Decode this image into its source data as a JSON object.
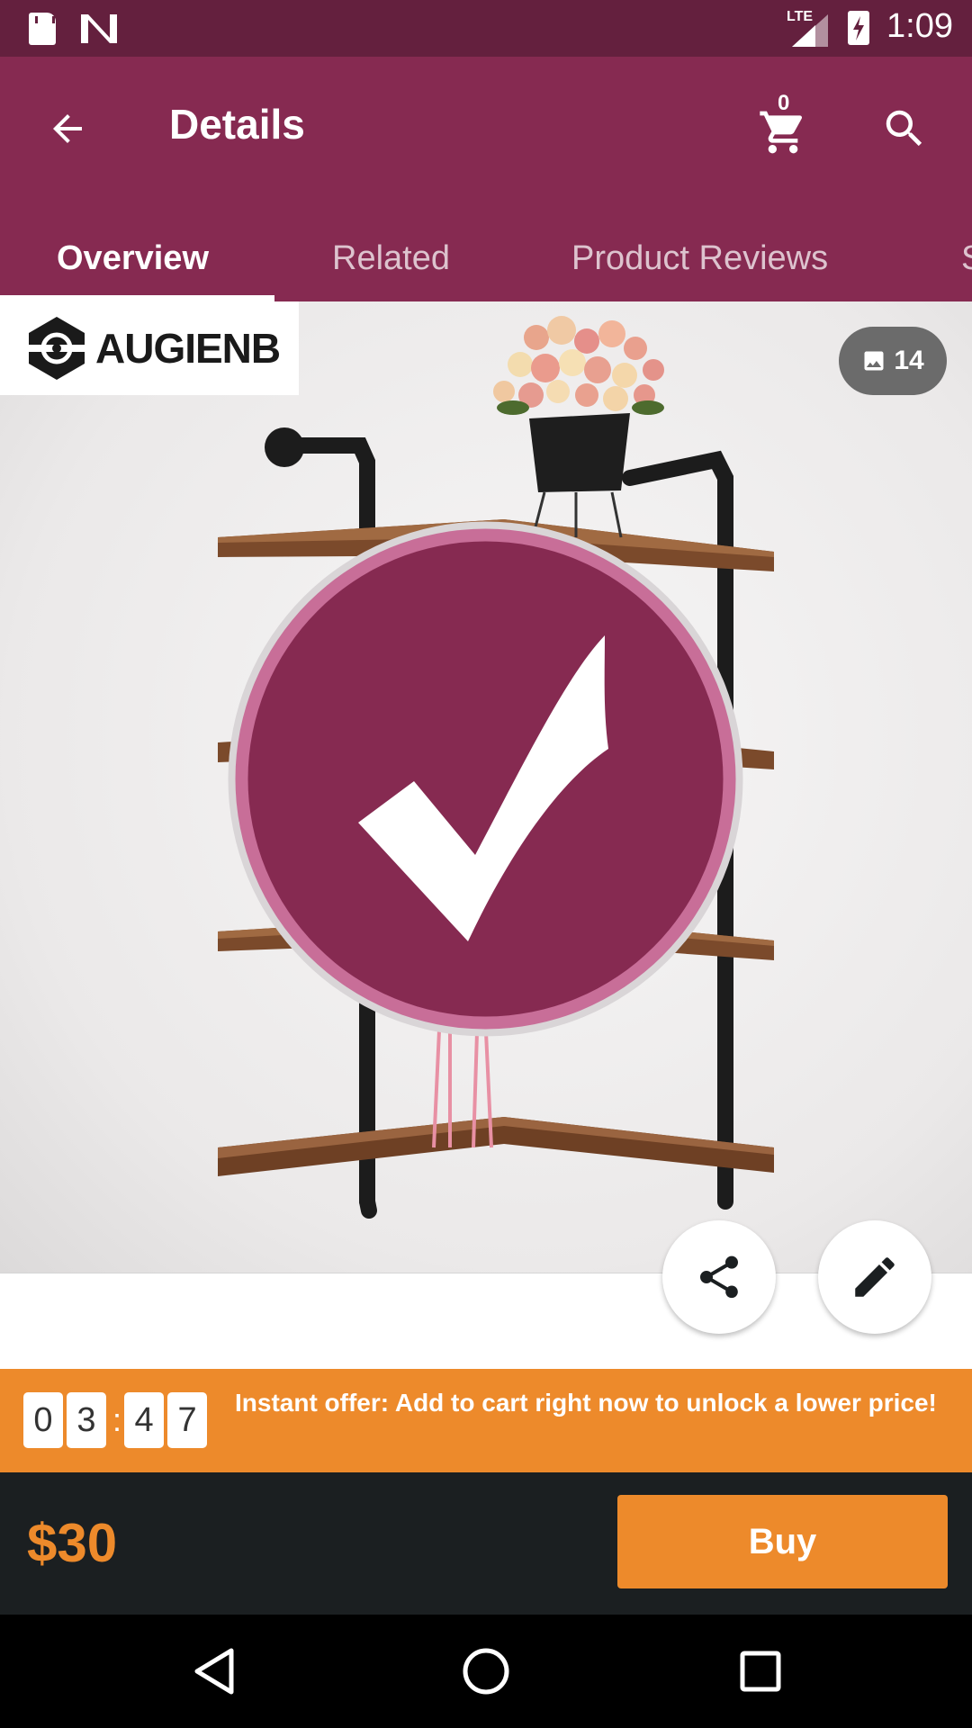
{
  "status_bar": {
    "network": "LTE",
    "time": "1:09",
    "icons": [
      "sd-card-icon",
      "n-notification-icon",
      "signal-icon",
      "battery-charging-icon"
    ]
  },
  "header": {
    "title": "Details",
    "cart_count": "0",
    "icons": {
      "back": "arrow-left-icon",
      "cart": "cart-icon",
      "search": "search-icon"
    }
  },
  "tabs": [
    {
      "label": "Overview",
      "active": true
    },
    {
      "label": "Related",
      "active": false
    },
    {
      "label": "Product Reviews",
      "active": false
    },
    {
      "label": "S",
      "active": false
    }
  ],
  "product": {
    "brand": "AUGIENB",
    "photo_count": "14",
    "overlay": "checkmark-icon"
  },
  "actions": {
    "share_icon": "share-icon",
    "edit_icon": "pencil-icon"
  },
  "offer": {
    "countdown": [
      "0",
      "3",
      "4",
      "7"
    ],
    "separator": ":",
    "text": "Instant offer: Add to cart right now to unlock a lower price!"
  },
  "buy_bar": {
    "price": "$30",
    "buy_label": "Buy"
  },
  "colors": {
    "primary": "#862a51",
    "status_bar": "#64203e",
    "accent": "#ed8a2b",
    "dark_bar": "#1b1f21"
  }
}
